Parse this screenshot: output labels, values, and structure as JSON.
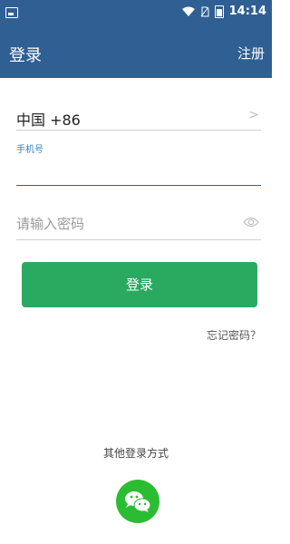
{
  "status_bar": {
    "time": "14:14"
  },
  "app_bar": {
    "title": "登录",
    "register": "注册"
  },
  "country": {
    "label": "中国 +86"
  },
  "phone": {
    "label": "手机号",
    "value": ""
  },
  "password": {
    "placeholder": "请输入密码"
  },
  "login_button": {
    "label": "登录"
  },
  "forgot_password": {
    "label": "忘记密码？"
  },
  "other_login": {
    "label": "其他登录方式"
  },
  "colors": {
    "primary": "#2f5f93",
    "accent_green": "#2aa960",
    "wechat_green": "#2bbd31"
  }
}
